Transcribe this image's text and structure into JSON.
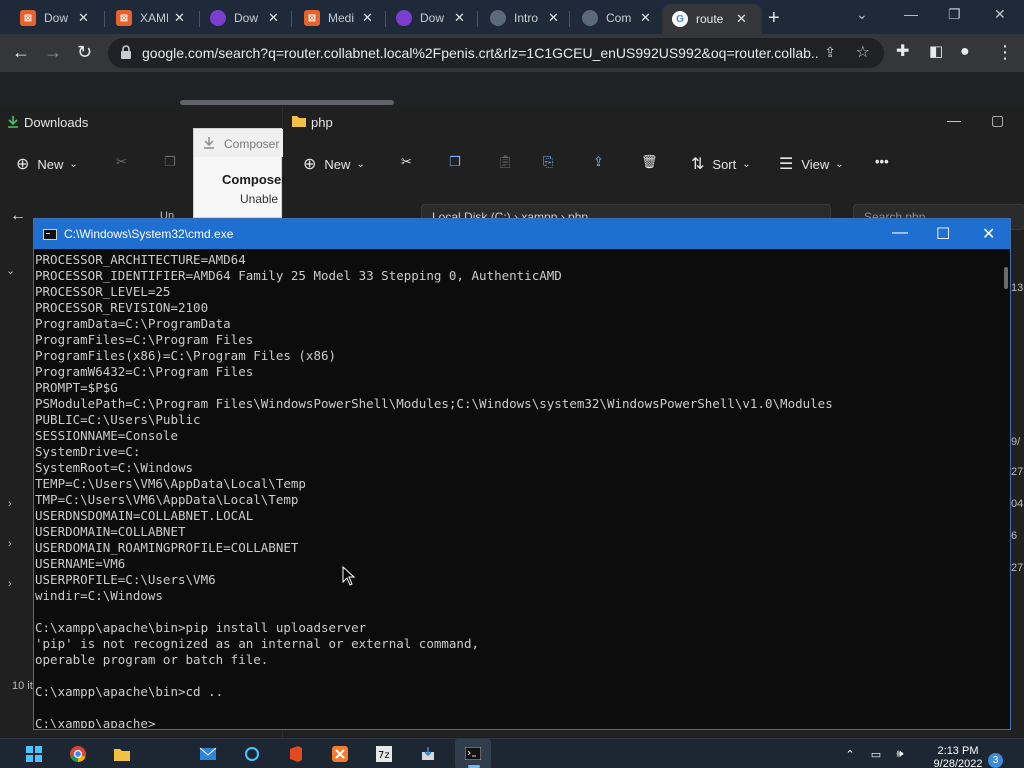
{
  "chrome": {
    "tabs": [
      {
        "title": "Dow",
        "icon": "xampp-icon"
      },
      {
        "title": "XAMP",
        "icon": "xampp-icon"
      },
      {
        "title": "Dow",
        "icon": "firefox-icon"
      },
      {
        "title": "Medi",
        "icon": "xampp-icon"
      },
      {
        "title": "Dow",
        "icon": "firefox-icon"
      },
      {
        "title": "Intro",
        "icon": "github-icon"
      },
      {
        "title": "Com",
        "icon": "github-icon"
      },
      {
        "title": "route",
        "icon": "google-icon"
      }
    ],
    "address": "google.com/search?q=router.collabnet.local%2Fpenis.crt&rlz=1C1GCEU_enUS992US992&oq=router.collab..."
  },
  "explorer_left": {
    "title": "Downloads",
    "new_label": "New",
    "fragments": [
      "Un",
      "10 it"
    ]
  },
  "composer_popup": {
    "header": "Composer",
    "bold": "Composer",
    "text": "Unable"
  },
  "explorer_right": {
    "title": "php",
    "new_label": "New",
    "sort_label": "Sort",
    "view_label": "View",
    "more_label": "•••",
    "path": "Local Disk (C:)  ›  xampp  ›  php",
    "search_placeholder": "Search php"
  },
  "cmd": {
    "title": "C:\\Windows\\System32\\cmd.exe",
    "lines": [
      "PROCESSOR_ARCHITECTURE=AMD64",
      "PROCESSOR_IDENTIFIER=AMD64 Family 25 Model 33 Stepping 0, AuthenticAMD",
      "PROCESSOR_LEVEL=25",
      "PROCESSOR_REVISION=2100",
      "ProgramData=C:\\ProgramData",
      "ProgramFiles=C:\\Program Files",
      "ProgramFiles(x86)=C:\\Program Files (x86)",
      "ProgramW6432=C:\\Program Files",
      "PROMPT=$P$G",
      "PSModulePath=C:\\Program Files\\WindowsPowerShell\\Modules;C:\\Windows\\system32\\WindowsPowerShell\\v1.0\\Modules",
      "PUBLIC=C:\\Users\\Public",
      "SESSIONNAME=Console",
      "SystemDrive=C:",
      "SystemRoot=C:\\Windows",
      "TEMP=C:\\Users\\VM6\\AppData\\Local\\Temp",
      "TMP=C:\\Users\\VM6\\AppData\\Local\\Temp",
      "USERDNSDOMAIN=COLLABNET.LOCAL",
      "USERDOMAIN=COLLABNET",
      "USERDOMAIN_ROAMINGPROFILE=COLLABNET",
      "USERNAME=VM6",
      "USERPROFILE=C:\\Users\\VM6",
      "windir=C:\\Windows",
      "",
      "C:\\xampp\\apache\\bin>pip install uploadserver",
      "'pip' is not recognized as an internal or external command,",
      "operable program or batch file.",
      "",
      "C:\\xampp\\apache\\bin>cd ..",
      "",
      "C:\\xampp\\apache>"
    ]
  },
  "taskbar": {
    "time": "2:13 PM",
    "date": "9/28/2022",
    "notifications": "3"
  }
}
